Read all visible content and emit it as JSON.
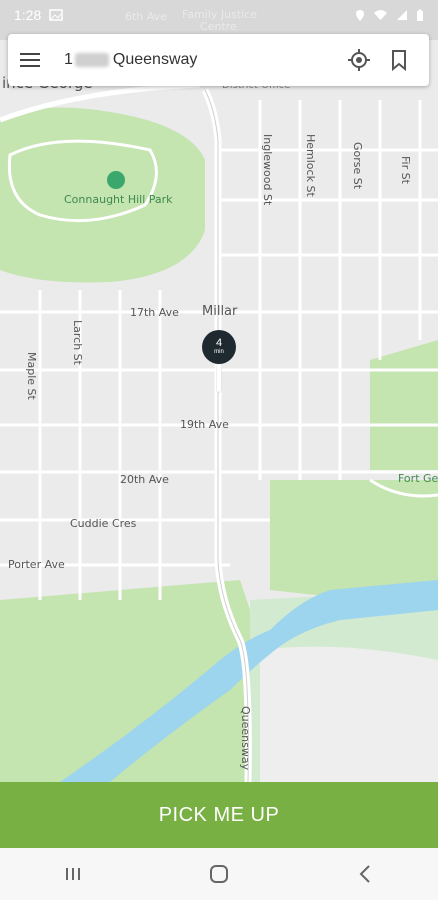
{
  "status": {
    "time": "1:28"
  },
  "search": {
    "address_prefix": "1",
    "address_street": "Queensway",
    "menu_icon": "hamburger-menu-icon",
    "locate_icon": "my-location-icon",
    "bookmark_icon": "bookmark-icon"
  },
  "map": {
    "labels": {
      "sixth_ave": "6th Ave",
      "family_justice": "Family Justice",
      "centre": "Centre",
      "district": "District Office",
      "prince_george": "ince George",
      "connaught": "Connaught Hill Park",
      "inglewood": "Inglewood St",
      "hemlock": "Hemlock St",
      "gorse": "Gorse St",
      "fir": "Fir St",
      "seventeenth": "17th Ave",
      "millar": "Millar",
      "larch": "Larch St",
      "maple": "Maple St",
      "nineteenth": "19th Ave",
      "twentieth": "20th Ave",
      "cuddie": "Cuddie Cres",
      "porter": "Porter Ave",
      "fort": "Fort Ge",
      "queensway": "Queensway"
    },
    "pin": {
      "minutes": "4",
      "unit": "min"
    }
  },
  "action": {
    "pickup_label": "PICK ME UP"
  },
  "colors": {
    "accent": "#78b043",
    "park": "#c4e4b0",
    "water": "#9dd4ee",
    "pin": "#1f2a30"
  }
}
